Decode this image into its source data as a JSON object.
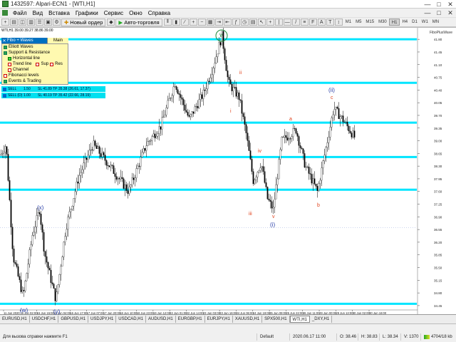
{
  "window": {
    "title": "1432597: Alpari-ECN1 - [WTI,H1]",
    "min": "—",
    "max": "□",
    "close": "✕"
  },
  "menu": [
    "Файл",
    "Вид",
    "Вставка",
    "Графики",
    "Сервис",
    "Окно",
    "Справка"
  ],
  "toolbar": {
    "new_order": "Новый ордер",
    "autotrade": "Авто-торговля",
    "timeframes": [
      "M1",
      "M5",
      "M15",
      "M30",
      "H1",
      "H4",
      "D1",
      "W1",
      "MN"
    ],
    "active_tf": "H1"
  },
  "chart": {
    "symbol_line": "WTI,H1  39.00 39.27 38.86 39.00",
    "plugin_label": "FiboPlusWave",
    "win_buttons": "_ □ ✕",
    "y_ticks": [
      "41.80",
      "41.45",
      "41.10",
      "40.75",
      "40.40",
      "40.05",
      "39.70",
      "39.35",
      "39.00",
      "38.65",
      "38.30",
      "37.95",
      "37.60",
      "37.25",
      "36.90",
      "36.55",
      "36.20",
      "35.85",
      "35.50",
      "35.15",
      "34.80",
      "34.45"
    ],
    "x_ticks": [
      "11 Jun 2020",
      "15 Jun 02:00",
      "15 Jun 15:00",
      "16 Jun 04:00",
      "16 Jun 17:00",
      "17 Jun 07:00",
      "17 Jun 20:00",
      "18 Jun 10:00",
      "18 Jun 23:00",
      "19 Jun 12:00",
      "22 Jun 01:00",
      "22 Jun 14:00",
      "23 Jun 03:00",
      "23 Jun 16:00",
      "24 Jun 06:00",
      "24 Jun 19:00",
      "25 Jun 09:00",
      "25 Jun 22:00",
      "26 Jun 11:00",
      "29 Jun 00:00",
      "29 Jun 13:00",
      "30 Jun 02:00",
      "30 Jun 16:00"
    ],
    "level_prices": [
      41.8,
      40.6,
      39.5,
      38.55,
      37.65,
      34.5
    ],
    "wave_labels": {
      "w": "(w)",
      "x": "(x)",
      "y": "(y)",
      "v_top": "v",
      "ii_big": "(ii)",
      "i_big": "(i)",
      "ii": "ii",
      "i": "i",
      "iv": "iv",
      "iii": "iii",
      "v": "v",
      "a": "a",
      "b": "b",
      "c": "c"
    },
    "colors": {
      "level": "#00e5ff",
      "candle": "#000000",
      "wave_blue": "#2a3fa8",
      "wave_red": "#e0401a",
      "circle": "#1f8a3a"
    }
  },
  "panel": {
    "head": "Fibo + Waves",
    "main": "Main",
    "rows": [
      "Elliott Waves",
      "Support & Resistance",
      "Horizontal line",
      "Trend line",
      "Sup",
      "Res",
      "Channel",
      "Fibonacci levels",
      "Events & Trading"
    ]
  },
  "trades": [
    {
      "side": "SELL",
      "ticket": "1",
      "lots": "1.50",
      "info": "SL 41.89 TP 35.38 (26.61, 17.37)"
    },
    {
      "side": "SELL (D)",
      "ticket": "1",
      "lots": "1.00",
      "info": "SL 40.19 TP 35.42 (22.66, 28.19)"
    }
  ],
  "tabs": [
    "EURUSD,H1",
    "USDCHF,H1",
    "GBPUSD,H1",
    "USDJPY,H1",
    "USDCAD,H1",
    "AUDUSD,H1",
    "EURGBP,H1",
    "EURJPY,H1",
    "XAUUSD,H1",
    "SPX500,H1",
    "WTI,H1",
    "_DXY,H1"
  ],
  "active_tab": "WTI,H1",
  "status": {
    "help": "Для вызова справки нажмите F1",
    "profile": "Default",
    "datetime": "2020.06.17 11:00",
    "open": "O: 38.46",
    "high": "H: 38.83",
    "low": "L: 38.34",
    "volume": "V: 1370",
    "traffic": "4704/18 kb"
  }
}
